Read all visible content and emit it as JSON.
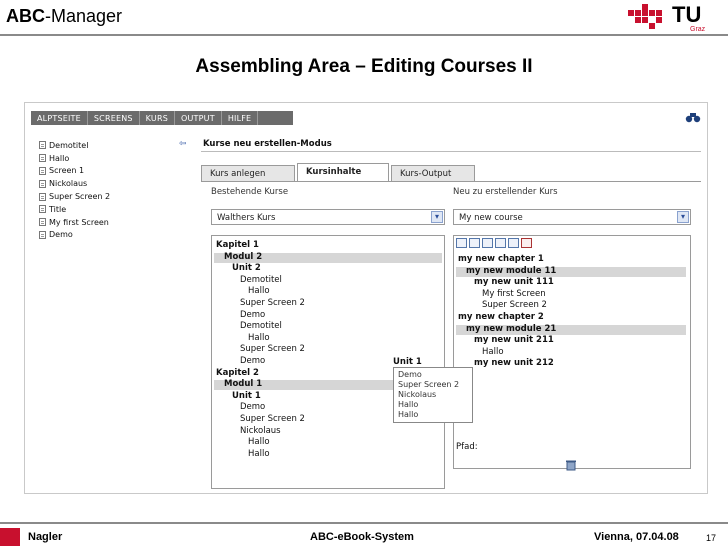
{
  "slide": {
    "title_bold": "ABC",
    "title_rest": "-Manager",
    "heading": "Assembling Area – Editing Courses II",
    "logo_text": "TU",
    "logo_sub": "Graz",
    "footer_author": "Nagler",
    "footer_center": "ABC-eBook-System",
    "footer_date": "Vienna, 07.04.08",
    "footer_page": "17",
    "accent_color": "#c8102e"
  },
  "app": {
    "menu": [
      "ALPTSEITE",
      "SCREENS",
      "KURS",
      "OUTPUT",
      "HILFE"
    ],
    "sidebar_items": [
      "Demotitel",
      "Hallo",
      "Screen 1",
      "Nickolaus",
      "Super Screen 2",
      "Title",
      "My first Screen",
      "Demo"
    ],
    "main_title": "Kurse neu erstellen-Modus",
    "tabs": [
      {
        "label": "Kurs anlegen",
        "active": false
      },
      {
        "label": "Kursinhalte",
        "active": true
      },
      {
        "label": "Kurs-Output",
        "active": false
      }
    ],
    "left_panel": {
      "label": "Bestehende Kurse",
      "select_value": "Walthers Kurs",
      "tree": [
        {
          "text": "Kapitel 1",
          "bold": true,
          "indent": 0,
          "highlight": false
        },
        {
          "text": "Modul 2",
          "bold": true,
          "indent": 1,
          "highlight": true
        },
        {
          "text": "Unit 2",
          "bold": true,
          "indent": 2,
          "highlight": false
        },
        {
          "text": "Demotitel",
          "bold": false,
          "indent": 3,
          "highlight": false
        },
        {
          "text": "Hallo",
          "bold": false,
          "indent": 4,
          "highlight": false
        },
        {
          "text": "Super Screen 2",
          "bold": false,
          "indent": 3,
          "highlight": false
        },
        {
          "text": "Demo",
          "bold": false,
          "indent": 3,
          "highlight": false
        },
        {
          "text": "Demotitel",
          "bold": false,
          "indent": 3,
          "highlight": false
        },
        {
          "text": "Hallo",
          "bold": false,
          "indent": 4,
          "highlight": false
        },
        {
          "text": "Super Screen 2",
          "bold": false,
          "indent": 3,
          "highlight": false
        },
        {
          "text": "Demo",
          "bold": false,
          "indent": 3,
          "highlight": false
        },
        {
          "text": "Kapitel 2",
          "bold": true,
          "indent": 0,
          "highlight": false
        },
        {
          "text": "Modul 1",
          "bold": true,
          "indent": 1,
          "highlight": true
        },
        {
          "text": "Unit 1",
          "bold": true,
          "indent": 2,
          "highlight": false
        },
        {
          "text": "Demo",
          "bold": false,
          "indent": 3,
          "highlight": false
        },
        {
          "text": "Super Screen 2",
          "bold": false,
          "indent": 3,
          "highlight": false
        },
        {
          "text": "Nickolaus",
          "bold": false,
          "indent": 3,
          "highlight": false
        },
        {
          "text": "Hallo",
          "bold": false,
          "indent": 4,
          "highlight": false
        },
        {
          "text": "Hallo",
          "bold": false,
          "indent": 4,
          "highlight": false
        }
      ]
    },
    "right_panel": {
      "label": "Neu zu erstellender Kurs",
      "select_value": "My new course",
      "tree": [
        {
          "text": "my new chapter 1",
          "bold": true,
          "indent": 0,
          "highlight": false
        },
        {
          "text": "my new module 11",
          "bold": true,
          "indent": 1,
          "highlight": true
        },
        {
          "text": "my new unit 111",
          "bold": true,
          "indent": 2,
          "highlight": false
        },
        {
          "text": "My first Screen",
          "bold": false,
          "indent": 3,
          "highlight": false
        },
        {
          "text": "Super Screen 2",
          "bold": false,
          "indent": 3,
          "highlight": false
        },
        {
          "text": "my new chapter 2",
          "bold": true,
          "indent": 0,
          "highlight": false
        },
        {
          "text": "my new module 21",
          "bold": true,
          "indent": 1,
          "highlight": true
        },
        {
          "text": "my new unit 211",
          "bold": true,
          "indent": 2,
          "highlight": false
        },
        {
          "text": "Hallo",
          "bold": false,
          "indent": 3,
          "highlight": false
        },
        {
          "text": "my new unit 212",
          "bold": true,
          "indent": 2,
          "highlight": false
        }
      ],
      "bottom_label": "Pfad:"
    },
    "drag_popup": {
      "title": "Unit 1",
      "items": [
        "Demo",
        "Super Screen 2",
        "Nickolaus",
        "Hallo",
        "Hallo"
      ]
    }
  }
}
